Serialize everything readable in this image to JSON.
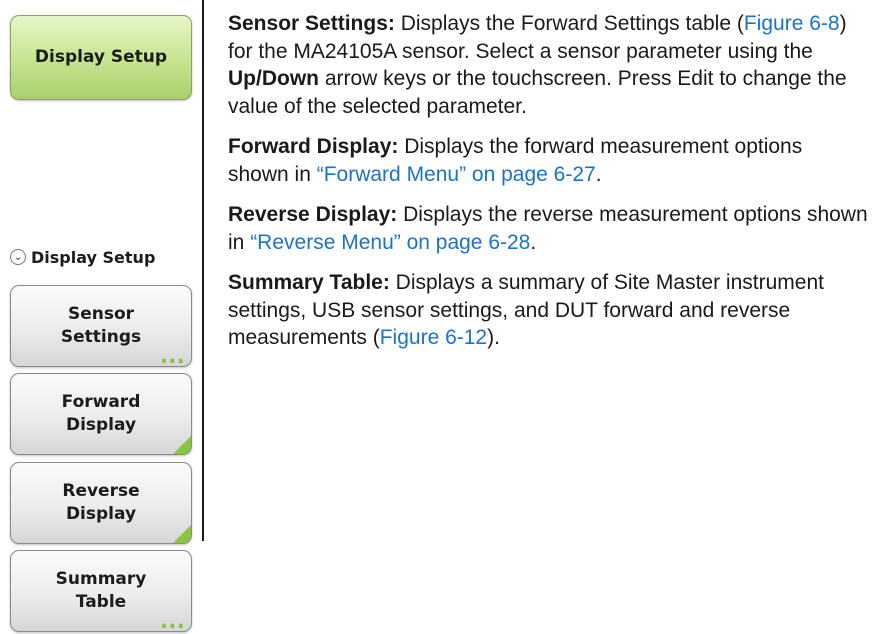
{
  "left_panel": {
    "title_button": "Display Setup",
    "menu_heading": "Display Setup",
    "buttons": [
      {
        "line1": "Sensor",
        "line2": "Settings",
        "indicator": "submenu-dots"
      },
      {
        "line1": "Forward",
        "line2": "Display",
        "indicator": "corner-triangle"
      },
      {
        "line1": "Reverse",
        "line2": "Display",
        "indicator": "corner-triangle"
      },
      {
        "line1": "Summary",
        "line2": "Table",
        "indicator": "submenu-dots"
      }
    ],
    "dots": "...",
    "chevron": "⌄"
  },
  "paragraphs": [
    {
      "term": "Sensor Settings:",
      "t1": "  Displays the Forward Settings table (",
      "link1": "Figure 6-8",
      "t2": ") for the MA24105A sensor. Select a sensor parameter using the ",
      "bold2": "Up/Down",
      "t3": " arrow keys or the touchscreen. Press Edit to change the value of the selected parameter."
    },
    {
      "term": "Forward Display:",
      "t1": "  Displays the forward measurement options shown in ",
      "link1": "“Forward Menu” on page 6-27",
      "t2": "."
    },
    {
      "term": "Reverse Display:",
      "t1": "  Displays the reverse measurement options shown in ",
      "link1": "“Reverse Menu” on page 6-28",
      "t2": "."
    },
    {
      "term": "Summary Table:",
      "t1": "  Displays a summary of Site Master instrument settings, USB sensor settings, and DUT forward and reverse measurements (",
      "link1": "Figure 6-12",
      "t2": ")."
    }
  ],
  "colors": {
    "link": "#1a73c9",
    "title_button": "#c4e48e",
    "indicator": "#8bc53f"
  }
}
